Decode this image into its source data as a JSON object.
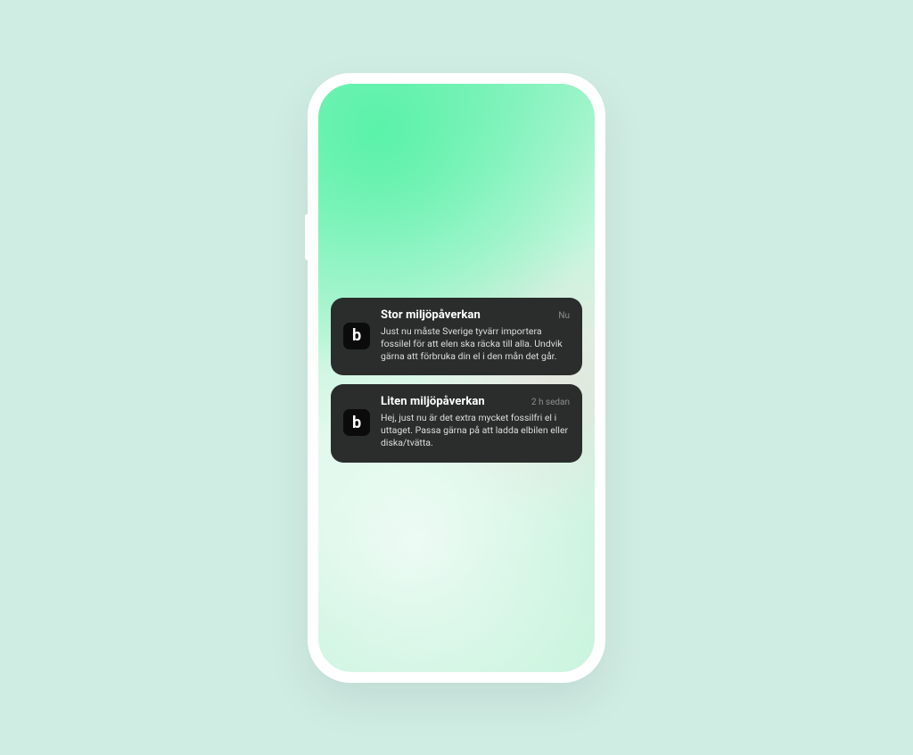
{
  "app_icon_letter": "b",
  "notifications": [
    {
      "title": "Stor miljöpåverkan",
      "time": "Nu",
      "body": "Just nu måste Sverige tyvärr importera fossilel för att elen ska räcka till alla. Undvik gärna att förbruka din el i den mån det går."
    },
    {
      "title": "Liten miljöpåverkan",
      "time": "2 h sedan",
      "body": "Hej, just nu är det extra mycket fossilfri el i uttaget. Passa gärna på att ladda elbilen eller diska/tvätta."
    }
  ]
}
